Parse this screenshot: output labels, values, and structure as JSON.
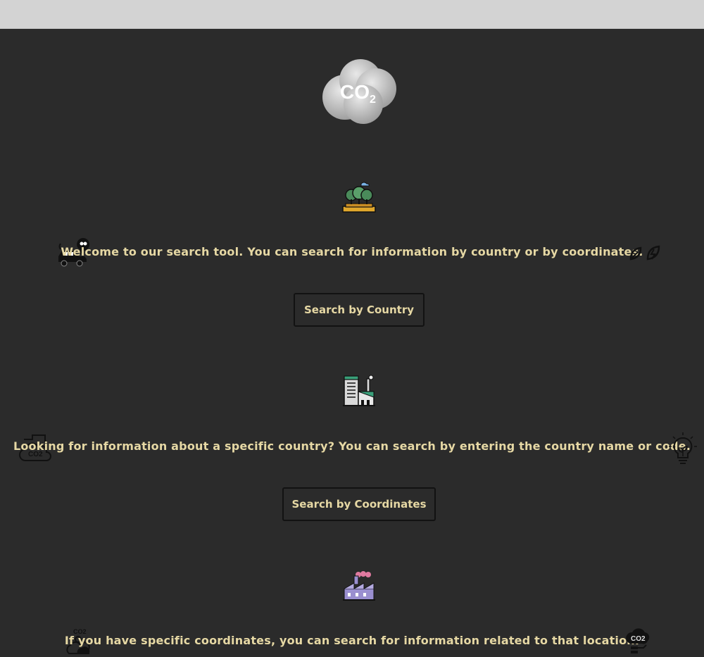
{
  "logo": {
    "text": "CO",
    "subscript": "2"
  },
  "sections": [
    {
      "message": "Welcome to our search tool. You can search for information by country or by coordinates.",
      "button": "Search by Country"
    },
    {
      "message": "Looking for information about a specific country? You can search by entering the country name or code.",
      "button": "Search by Coordinates"
    },
    {
      "message": "If you have specific coordinates, you can search for information related to that location."
    }
  ],
  "icons": {
    "center_1": "forest-icon",
    "center_2": "factory-building-icon",
    "center_3": "factory-smoke-icon",
    "left_1": "car-emission-icon",
    "right_1": "leaf-energy-icon",
    "left_2": "co2-cloud-icon",
    "right_2": "lightbulb-plant-icon",
    "left_3": "co2-cloud-small-icon",
    "right_3": "co2-smoke-icon"
  },
  "colors": {
    "background": "#2b2b2b",
    "topbar": "#d3d3d3",
    "text": "#e6d8a4"
  }
}
